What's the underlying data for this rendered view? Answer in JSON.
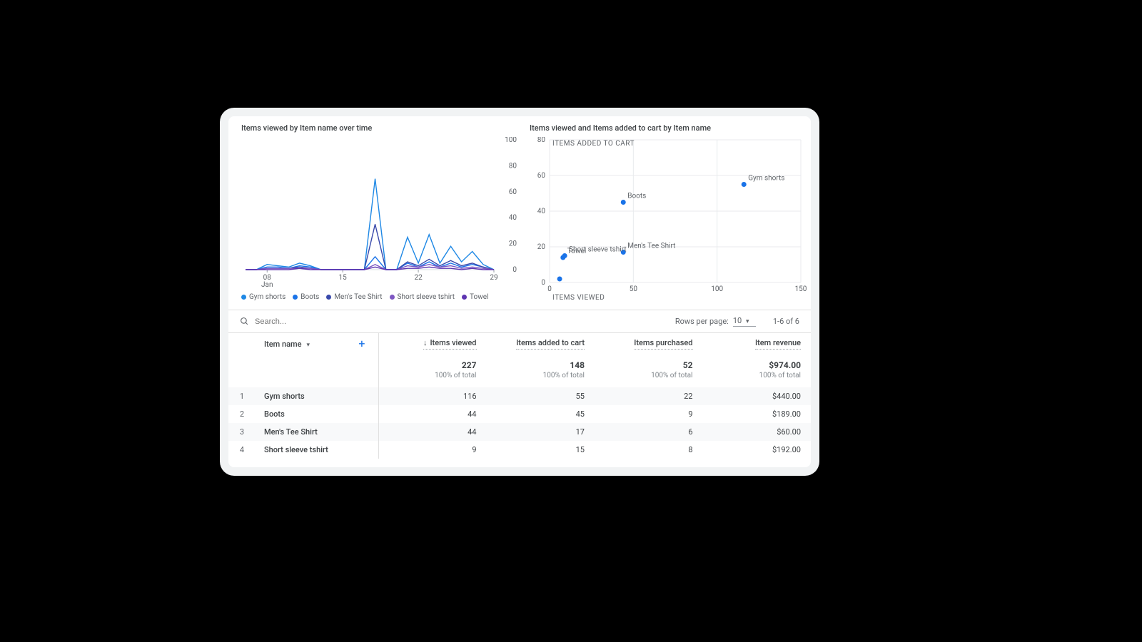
{
  "charts": {
    "line": {
      "title": "Items viewed by Item name over time",
      "legend": [
        {
          "name": "Gym shorts",
          "color": "#1e88e5"
        },
        {
          "name": "Boots",
          "color": "#1a73e8"
        },
        {
          "name": "Men's Tee Shirt",
          "color": "#3949ab"
        },
        {
          "name": "Short sleeve tshirt",
          "color": "#7e57c2"
        },
        {
          "name": "Towel",
          "color": "#5e35b1"
        }
      ]
    },
    "scatter": {
      "title": "Items viewed and Items added to cart by Item name",
      "x_axis": "ITEMS VIEWED",
      "y_axis": "ITEMS ADDED TO CART"
    }
  },
  "chart_data": [
    {
      "type": "line",
      "title": "Items viewed by Item name over time",
      "xlabel": "Jan",
      "ylabel": "",
      "ylim": [
        0,
        100
      ],
      "y_ticks": [
        0,
        20,
        40,
        60,
        80,
        100
      ],
      "x_ticks": [
        "08",
        "15",
        "22",
        "29"
      ],
      "x": [
        6,
        7,
        8,
        9,
        10,
        11,
        12,
        13,
        14,
        15,
        16,
        17,
        18,
        19,
        20,
        21,
        22,
        23,
        24,
        25,
        26,
        27,
        28,
        29
      ],
      "series": [
        {
          "name": "Gym shorts",
          "color": "#1e88e5",
          "values": [
            0,
            0,
            4,
            3,
            2,
            5,
            3,
            0,
            0,
            0,
            0,
            0,
            70,
            0,
            0,
            25,
            5,
            27,
            5,
            18,
            6,
            14,
            4,
            0
          ]
        },
        {
          "name": "Boots",
          "color": "#1a73e8",
          "values": [
            0,
            0,
            2,
            2,
            1,
            3,
            2,
            0,
            0,
            0,
            0,
            0,
            10,
            0,
            0,
            5,
            2,
            6,
            2,
            5,
            2,
            4,
            2,
            0
          ]
        },
        {
          "name": "Men's Tee Shirt",
          "color": "#3949ab",
          "values": [
            0,
            0,
            1,
            1,
            1,
            2,
            1,
            0,
            0,
            0,
            0,
            0,
            35,
            0,
            0,
            6,
            3,
            8,
            3,
            7,
            3,
            5,
            2,
            0
          ]
        },
        {
          "name": "Short sleeve tshirt",
          "color": "#7e57c2",
          "values": [
            0,
            0,
            1,
            1,
            1,
            1,
            1,
            0,
            0,
            0,
            0,
            0,
            4,
            0,
            0,
            3,
            2,
            4,
            2,
            3,
            1,
            2,
            1,
            0
          ]
        },
        {
          "name": "Towel",
          "color": "#5e35b1",
          "values": [
            0,
            0,
            0,
            0,
            0,
            1,
            0,
            0,
            0,
            0,
            0,
            0,
            2,
            0,
            0,
            1,
            1,
            2,
            1,
            1,
            0,
            1,
            0,
            0
          ]
        }
      ]
    },
    {
      "type": "scatter",
      "title": "Items viewed and Items added to cart by Item name",
      "xlabel": "ITEMS VIEWED",
      "ylabel": "ITEMS ADDED TO CART",
      "xlim": [
        0,
        150
      ],
      "ylim": [
        0,
        80
      ],
      "x_ticks": [
        0,
        50,
        100,
        150
      ],
      "y_ticks": [
        0,
        20,
        40,
        60,
        80
      ],
      "points": [
        {
          "name": "Gym shorts",
          "x": 116,
          "y": 55
        },
        {
          "name": "Boots",
          "x": 44,
          "y": 45
        },
        {
          "name": "Men's Tee Shirt",
          "x": 44,
          "y": 17
        },
        {
          "name": "Short sleeve tshirt",
          "x": 9,
          "y": 15
        },
        {
          "name": "Towel",
          "x": 8,
          "y": 14
        },
        {
          "name": "",
          "x": 6,
          "y": 2
        }
      ],
      "point_color": "#1a73e8"
    }
  ],
  "controls": {
    "search_placeholder": "Search...",
    "rows_per_page_label": "Rows per page:",
    "rows_per_page_value": "10",
    "range": "1-6 of 6"
  },
  "table": {
    "dimension_label": "Item name",
    "columns": [
      {
        "label": "Items viewed",
        "sorted": true
      },
      {
        "label": "Items added to cart"
      },
      {
        "label": "Items purchased"
      },
      {
        "label": "Item revenue"
      }
    ],
    "totals": {
      "sub": "100% of total",
      "values": [
        "227",
        "148",
        "52",
        "$974.00"
      ]
    },
    "rows": [
      {
        "idx": "1",
        "name": "Gym shorts",
        "v": [
          "116",
          "55",
          "22",
          "$440.00"
        ]
      },
      {
        "idx": "2",
        "name": "Boots",
        "v": [
          "44",
          "45",
          "9",
          "$189.00"
        ]
      },
      {
        "idx": "3",
        "name": "Men's Tee Shirt",
        "v": [
          "44",
          "17",
          "6",
          "$60.00"
        ]
      },
      {
        "idx": "4",
        "name": "Short sleeve tshirt",
        "v": [
          "9",
          "15",
          "8",
          "$192.00"
        ]
      }
    ]
  }
}
